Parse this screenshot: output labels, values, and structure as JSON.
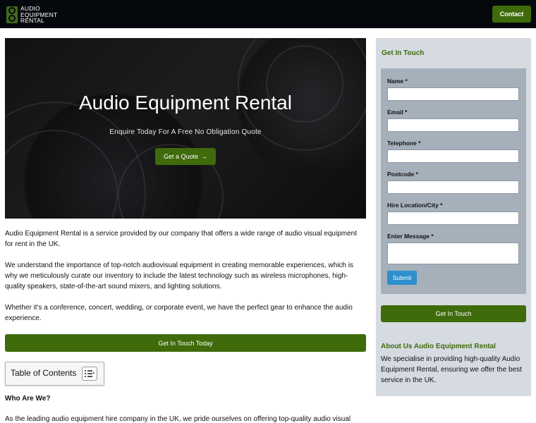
{
  "header": {
    "logo_lines": [
      "AUDIO",
      "EQUIPMENT",
      "RENTAL"
    ],
    "contact_label": "Contact"
  },
  "hero": {
    "title": "Audio Equipment Rental",
    "subtitle": "Enquire Today For A Free No Obligation Quote",
    "quote_button": "Get a Quote",
    "quote_icon": "→"
  },
  "main": {
    "paragraphs": [
      "Audio Equipment Rental is a service provided by our company that offers a wide range of audio visual equipment for rent in the UK.",
      "We understand the importance of top-notch audiovisual equipment in creating memorable experiences, which is why we meticulously curate our inventory to include the latest technology such as wireless microphones, high-quality speakers, state-of-the-art sound mixers, and lighting solutions.",
      "Whether it's a conference, concert, wedding, or corporate event, we have the perfect gear to enhance the audio experience."
    ],
    "cta_label": "Get In Touch Today",
    "toc_title": "Table of Contents",
    "who_heading": "Who Are We?",
    "last_paragraph": "As the leading audio equipment hire company in the UK, we pride ourselves on offering top-quality audio visual"
  },
  "sidebar": {
    "title": "Get In Touch",
    "form": {
      "name_label": "Name *",
      "email_label": "Email *",
      "telephone_label": "Telephone *",
      "postcode_label": "Postcode *",
      "location_label": "Hire Location/City *",
      "message_label": "Enter Message *",
      "submit_label": "Submit"
    },
    "cta_label": "Get In Touch",
    "about_title": "About Us Audio Equipment Rental",
    "about_text": "We specialise in providing high-quality Audio Equipment Rental, ensuring we offer the best service in the UK."
  },
  "colors": {
    "brand_green": "#3f6b0b",
    "header_bg": "#05080d",
    "sidebar_bg": "#d6dbe1",
    "form_bg": "#a5b0bb",
    "submit_blue": "#2d8fcc"
  }
}
